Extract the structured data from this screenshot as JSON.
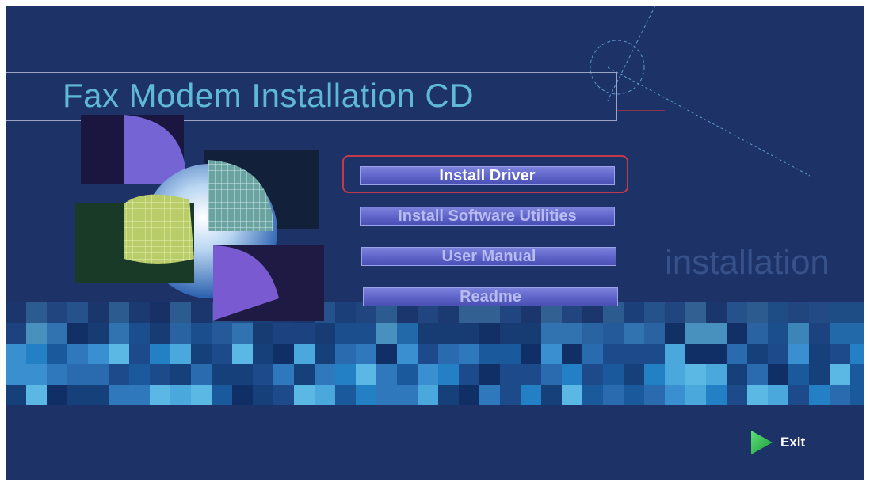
{
  "window": {
    "title": "Fax Modem Installation CD",
    "watermark": "installation"
  },
  "menu": {
    "items": [
      {
        "label": "Install Driver",
        "selected": true
      },
      {
        "label": "Install Software Utilities",
        "selected": false
      },
      {
        "label": "User Manual",
        "selected": false
      },
      {
        "label": "Readme",
        "selected": false
      }
    ]
  },
  "footer": {
    "exit_label": "Exit"
  },
  "colors": {
    "background": "#1d3266",
    "title": "#5fb9d6",
    "button": "#5e63c8",
    "highlight": "#c23a4a",
    "exit_arrow": "#27b34a"
  },
  "icons": {
    "logo": "sphere-collage-icon",
    "exit": "play-arrow-icon"
  }
}
